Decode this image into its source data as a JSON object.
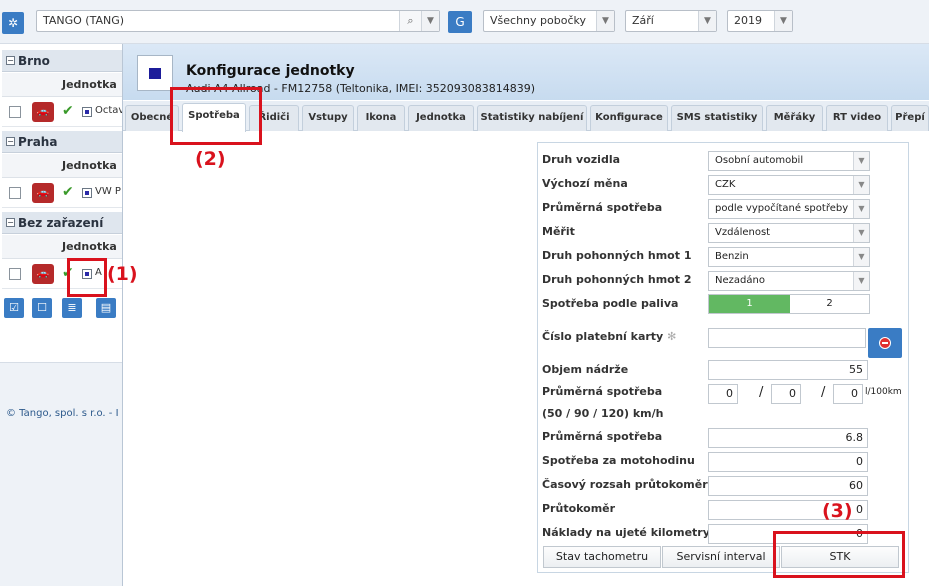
{
  "topbar": {
    "unit_combo": "TANGO (TANG)",
    "g_button": "G",
    "branch_combo": "Všechny pobočky",
    "month_combo": "Září",
    "year_combo": "2019"
  },
  "sidebar": {
    "groups": [
      {
        "name": "Brno",
        "column": "Jednotka",
        "row_text": "Octav"
      },
      {
        "name": "Praha",
        "column": "Jednotka",
        "row_text": "VW P"
      },
      {
        "name": "Bez zařazení",
        "column": "Jednotka",
        "row_text": "A"
      }
    ],
    "copyright": "© Tango, spol. s r.o. - I"
  },
  "dialog": {
    "title": "Konfigurace jednotky",
    "subtitle": "Audi A4 Allroad - FM12758 (Teltonika, IMEI: 352093083814839)",
    "tabs": [
      "Obecné",
      "Spotřeba",
      "Řidiči",
      "Vstupy",
      "Ikona",
      "Jednotka",
      "Statistiky nabíjení",
      "Konfigurace",
      "SMS statistiky",
      "Měřáky",
      "RT video",
      "Přepí"
    ],
    "active_tab": "Spotřeba"
  },
  "form": {
    "druh_vozidla": {
      "label": "Druh vozidla",
      "value": "Osobní automobil"
    },
    "vychozi_mena": {
      "label": "Výchozí měna",
      "value": "CZK"
    },
    "prumerna_spotreba_mode": {
      "label": "Průměrná spotřeba",
      "value": "podle vypočítané spotřeby"
    },
    "merit": {
      "label": "Měřit",
      "value": "Vzdálenost"
    },
    "pohonne_hmoty_1": {
      "label": "Druh pohonných hmot 1",
      "value": "Benzin"
    },
    "pohonne_hmoty_2": {
      "label": "Druh pohonných hmot 2",
      "value": "Nezadáno"
    },
    "spotreba_podle_paliva": {
      "label": "Spotřeba podle paliva",
      "opt1": "1",
      "opt2": "2"
    },
    "cislo_karty": {
      "label": "Číslo platební karty",
      "value": ""
    },
    "objem_nadrze": {
      "label": "Objem nádrže",
      "value": "55"
    },
    "spotreba_rychlosti": {
      "label": "Průměrná spotřeba",
      "label2": "(50 / 90 / 120) km/h",
      "v50": "0",
      "v90": "0",
      "v120": "0",
      "sep": "/",
      "unit": "l/100km"
    },
    "prumerna_spotreba": {
      "label": "Průměrná spotřeba",
      "value": "6.8"
    },
    "motohodina": {
      "label": "Spotřeba za motohodinu",
      "value": "0"
    },
    "rozsah_prutokomeru": {
      "label": "Časový rozsah průtokoměru",
      "value": "60"
    },
    "prutokomer": {
      "label": "Průtokoměr",
      "value": "0"
    },
    "naklady_km": {
      "label": "Náklady na ujeté kilometry",
      "value": "0"
    }
  },
  "buttons": {
    "stav_tachometru": "Stav tachometru",
    "servisni_interval": "Servisní interval",
    "stk": "STK"
  },
  "annotations": {
    "a1": "(1)",
    "a2": "(2)",
    "a3": "(3)"
  },
  "colors": {
    "annotation": "#d9121d",
    "accent": "#3a7cc4",
    "active_segment": "#62b862"
  }
}
